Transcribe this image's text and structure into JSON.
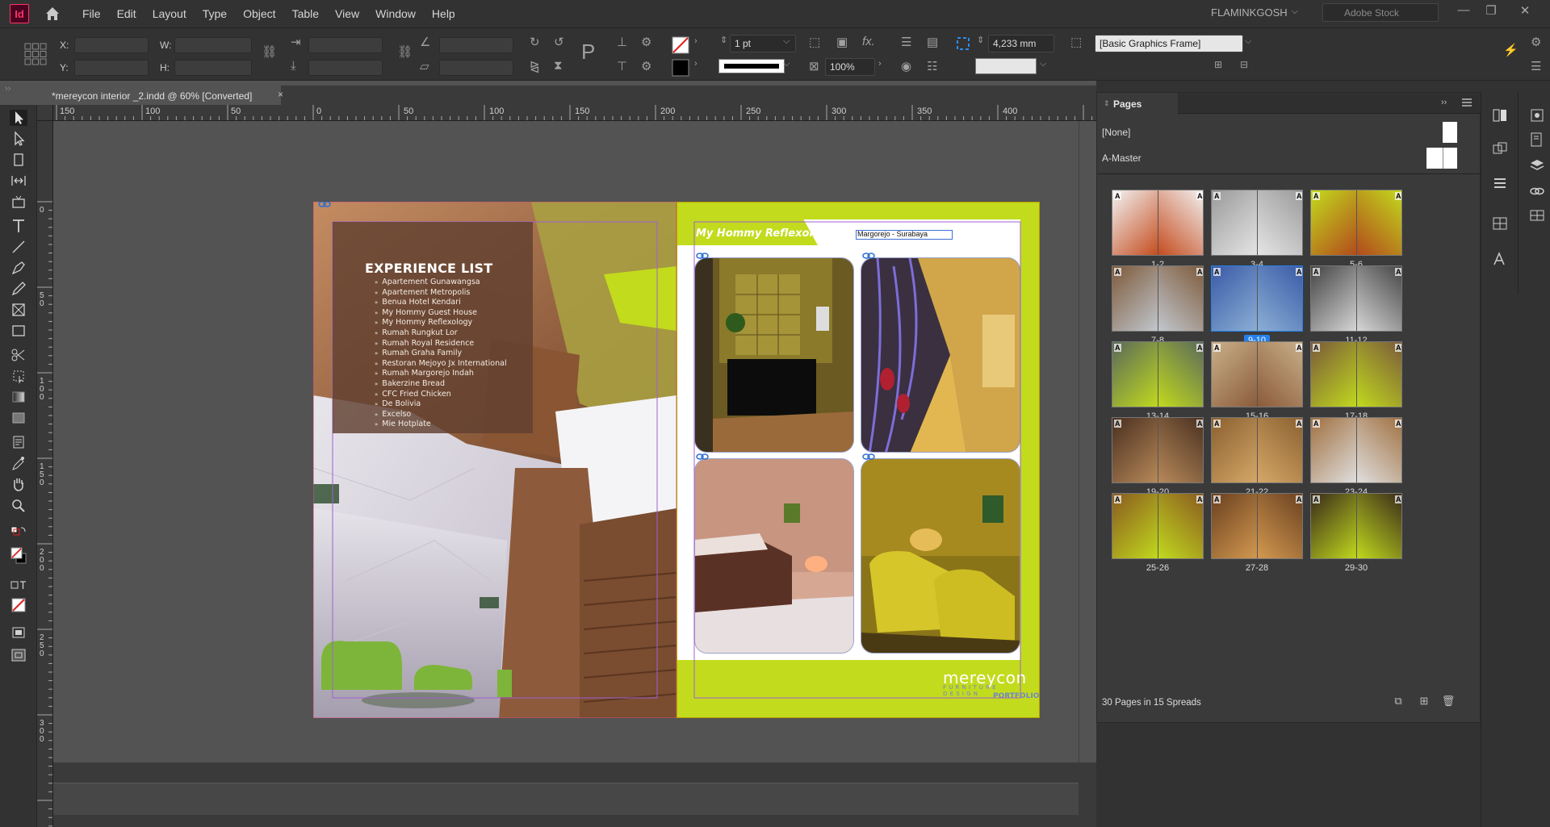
{
  "app": {
    "logo_text": "Id",
    "menu": [
      "File",
      "Edit",
      "Layout",
      "Type",
      "Object",
      "Table",
      "View",
      "Window",
      "Help"
    ],
    "workspace": "FLAMINKGOSH",
    "stock_search_placeholder": "Adobe Stock",
    "window_buttons": [
      "—",
      "❐",
      "✕"
    ]
  },
  "controlbar": {
    "x_label": "X:",
    "y_label": "Y:",
    "w_label": "W:",
    "h_label": "H:",
    "stroke_weight": "1 pt",
    "scale_percent": "100%",
    "gap_value": "4,233 mm",
    "object_style": "[Basic Graphics Frame]",
    "fx_label": "fx."
  },
  "document": {
    "tab_title": "*mereycon interior _2.indd @ 60% [Converted]",
    "tab_close": "×"
  },
  "rulers": {
    "horizontal_labels": [
      "150",
      "100",
      "50",
      "0",
      "50",
      "100",
      "150",
      "200",
      "250",
      "300",
      "350",
      "400"
    ],
    "vertical_labels": [
      "0",
      "5\n0",
      "1\n0\n0",
      "1\n5\n0",
      "2\n0\n0",
      "2\n5\n0",
      "3\n0\n0"
    ]
  },
  "left_page": {
    "title": "EXPERIENCE LIST",
    "items": [
      "Apartement Gunawangsa",
      "Apartement Metropolis",
      "Benua Hotel Kendari",
      "My Hommy Guest House",
      "My Hommy Reflexology",
      "Rumah Rungkut Lor",
      "Rumah Royal Residence",
      "Rumah Graha Family",
      "Restoran Mejoyo Jx International",
      "Rumah Margorejo Indah",
      "Bakerzine Bread",
      "CFC Fried Chicken",
      "De Bolivia",
      "Excelso",
      "Mie Hotplate"
    ]
  },
  "right_page": {
    "title": "My Hommy Reflexology",
    "location": "Margorejo - Surabaya",
    "brand_name": "mereycon",
    "brand_tagline": "FURNITURE DESIGN",
    "brand_portfolio": "PORTFOLIO"
  },
  "pages_panel": {
    "tab_label": "Pages",
    "masters": [
      "[None]",
      "A-Master"
    ],
    "spreads": [
      {
        "label": "1-2"
      },
      {
        "label": "3-4"
      },
      {
        "label": "5-6"
      },
      {
        "label": "7-8"
      },
      {
        "label": "9-10",
        "selected": true
      },
      {
        "label": "11-12"
      },
      {
        "label": "13-14"
      },
      {
        "label": "15-16"
      },
      {
        "label": "17-18"
      },
      {
        "label": "19-20"
      },
      {
        "label": "21-22"
      },
      {
        "label": "23-24"
      },
      {
        "label": "25-26"
      },
      {
        "label": "27-28"
      },
      {
        "label": "29-30"
      }
    ],
    "master_badge": "A",
    "status": "30 Pages in 15 Spreads"
  },
  "colors": {
    "accent_lime": "#c2db1d",
    "selection_blue": "#2680eb",
    "indesign_pink": "#ff3366"
  }
}
